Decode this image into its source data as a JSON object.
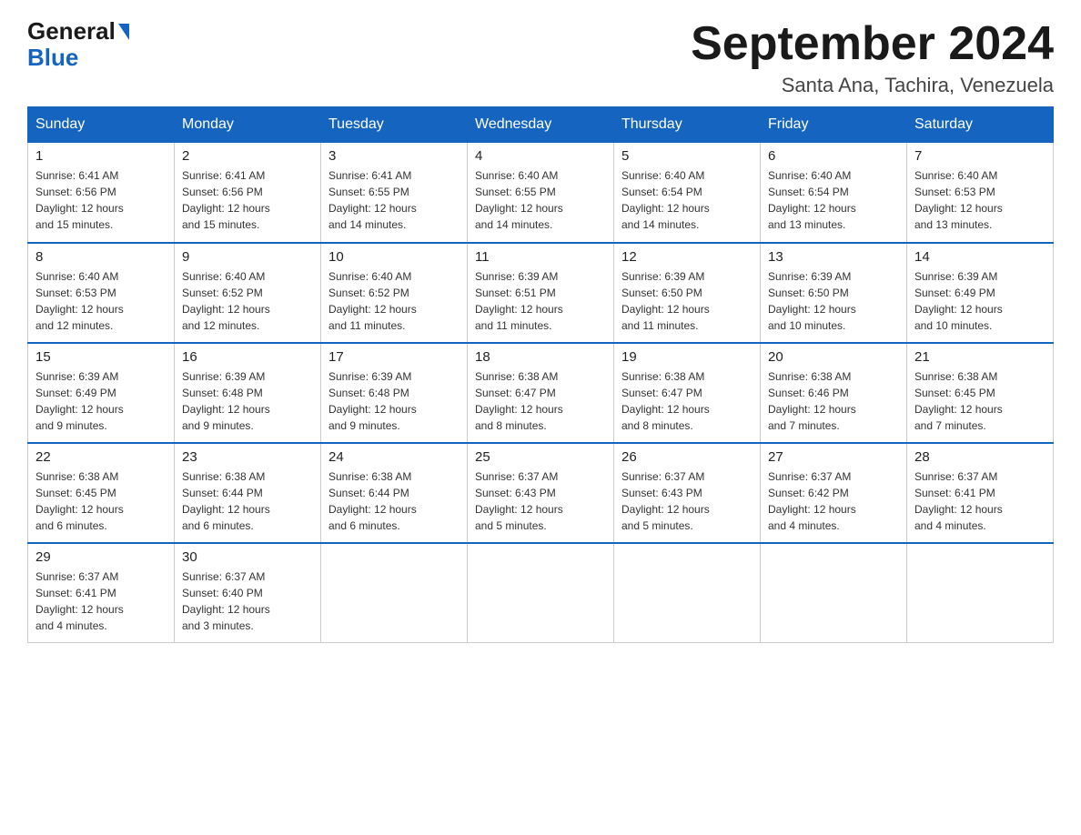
{
  "logo": {
    "line1": "General",
    "line2": "Blue"
  },
  "title": "September 2024",
  "subtitle": "Santa Ana, Tachira, Venezuela",
  "days_header": [
    "Sunday",
    "Monday",
    "Tuesday",
    "Wednesday",
    "Thursday",
    "Friday",
    "Saturday"
  ],
  "weeks": [
    [
      {
        "day": "1",
        "sunrise": "6:41 AM",
        "sunset": "6:56 PM",
        "daylight": "12 hours and 15 minutes."
      },
      {
        "day": "2",
        "sunrise": "6:41 AM",
        "sunset": "6:56 PM",
        "daylight": "12 hours and 15 minutes."
      },
      {
        "day": "3",
        "sunrise": "6:41 AM",
        "sunset": "6:55 PM",
        "daylight": "12 hours and 14 minutes."
      },
      {
        "day": "4",
        "sunrise": "6:40 AM",
        "sunset": "6:55 PM",
        "daylight": "12 hours and 14 minutes."
      },
      {
        "day": "5",
        "sunrise": "6:40 AM",
        "sunset": "6:54 PM",
        "daylight": "12 hours and 14 minutes."
      },
      {
        "day": "6",
        "sunrise": "6:40 AM",
        "sunset": "6:54 PM",
        "daylight": "12 hours and 13 minutes."
      },
      {
        "day": "7",
        "sunrise": "6:40 AM",
        "sunset": "6:53 PM",
        "daylight": "12 hours and 13 minutes."
      }
    ],
    [
      {
        "day": "8",
        "sunrise": "6:40 AM",
        "sunset": "6:53 PM",
        "daylight": "12 hours and 12 minutes."
      },
      {
        "day": "9",
        "sunrise": "6:40 AM",
        "sunset": "6:52 PM",
        "daylight": "12 hours and 12 minutes."
      },
      {
        "day": "10",
        "sunrise": "6:40 AM",
        "sunset": "6:52 PM",
        "daylight": "12 hours and 11 minutes."
      },
      {
        "day": "11",
        "sunrise": "6:39 AM",
        "sunset": "6:51 PM",
        "daylight": "12 hours and 11 minutes."
      },
      {
        "day": "12",
        "sunrise": "6:39 AM",
        "sunset": "6:50 PM",
        "daylight": "12 hours and 11 minutes."
      },
      {
        "day": "13",
        "sunrise": "6:39 AM",
        "sunset": "6:50 PM",
        "daylight": "12 hours and 10 minutes."
      },
      {
        "day": "14",
        "sunrise": "6:39 AM",
        "sunset": "6:49 PM",
        "daylight": "12 hours and 10 minutes."
      }
    ],
    [
      {
        "day": "15",
        "sunrise": "6:39 AM",
        "sunset": "6:49 PM",
        "daylight": "12 hours and 9 minutes."
      },
      {
        "day": "16",
        "sunrise": "6:39 AM",
        "sunset": "6:48 PM",
        "daylight": "12 hours and 9 minutes."
      },
      {
        "day": "17",
        "sunrise": "6:39 AM",
        "sunset": "6:48 PM",
        "daylight": "12 hours and 9 minutes."
      },
      {
        "day": "18",
        "sunrise": "6:38 AM",
        "sunset": "6:47 PM",
        "daylight": "12 hours and 8 minutes."
      },
      {
        "day": "19",
        "sunrise": "6:38 AM",
        "sunset": "6:47 PM",
        "daylight": "12 hours and 8 minutes."
      },
      {
        "day": "20",
        "sunrise": "6:38 AM",
        "sunset": "6:46 PM",
        "daylight": "12 hours and 7 minutes."
      },
      {
        "day": "21",
        "sunrise": "6:38 AM",
        "sunset": "6:45 PM",
        "daylight": "12 hours and 7 minutes."
      }
    ],
    [
      {
        "day": "22",
        "sunrise": "6:38 AM",
        "sunset": "6:45 PM",
        "daylight": "12 hours and 6 minutes."
      },
      {
        "day": "23",
        "sunrise": "6:38 AM",
        "sunset": "6:44 PM",
        "daylight": "12 hours and 6 minutes."
      },
      {
        "day": "24",
        "sunrise": "6:38 AM",
        "sunset": "6:44 PM",
        "daylight": "12 hours and 6 minutes."
      },
      {
        "day": "25",
        "sunrise": "6:37 AM",
        "sunset": "6:43 PM",
        "daylight": "12 hours and 5 minutes."
      },
      {
        "day": "26",
        "sunrise": "6:37 AM",
        "sunset": "6:43 PM",
        "daylight": "12 hours and 5 minutes."
      },
      {
        "day": "27",
        "sunrise": "6:37 AM",
        "sunset": "6:42 PM",
        "daylight": "12 hours and 4 minutes."
      },
      {
        "day": "28",
        "sunrise": "6:37 AM",
        "sunset": "6:41 PM",
        "daylight": "12 hours and 4 minutes."
      }
    ],
    [
      {
        "day": "29",
        "sunrise": "6:37 AM",
        "sunset": "6:41 PM",
        "daylight": "12 hours and 4 minutes."
      },
      {
        "day": "30",
        "sunrise": "6:37 AM",
        "sunset": "6:40 PM",
        "daylight": "12 hours and 3 minutes."
      },
      null,
      null,
      null,
      null,
      null
    ]
  ]
}
